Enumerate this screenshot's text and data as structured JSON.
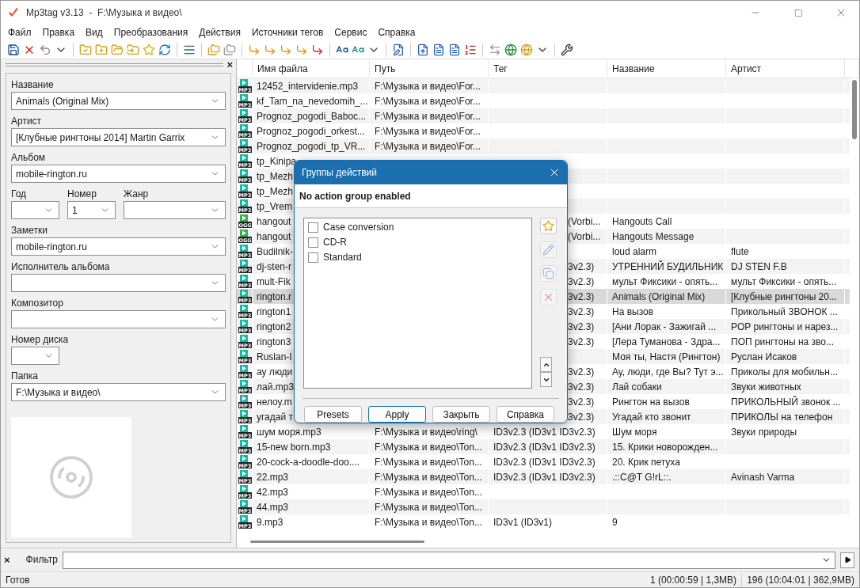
{
  "window": {
    "title": "Mp3tag v3.13  -  F:\\Музыка и видео\\"
  },
  "menu": [
    "Файл",
    "Правка",
    "Вид",
    "Преобразования",
    "Действия",
    "Источники тегов",
    "Сервис",
    "Справка"
  ],
  "tag_panel": {
    "close": "×",
    "rows": [
      [
        {
          "label": "Название",
          "value": "Animals (Original Mix)",
          "kind": "text"
        }
      ],
      [
        {
          "label": "Артист",
          "value": "[Клубные рингтоны 2014] Martin Garrix",
          "kind": "text"
        }
      ],
      [
        {
          "label": "Альбом",
          "value": "mobile-rington.ru",
          "kind": "text"
        }
      ],
      [
        {
          "label": "Год",
          "kind": "number"
        },
        {
          "label": "Номер",
          "value": "1",
          "kind": "number"
        },
        {
          "label": "Жанр",
          "kind": "text"
        }
      ],
      [
        {
          "label": "Заметки",
          "value": "mobile-rington.ru",
          "kind": "text"
        }
      ],
      [
        {
          "label": "Исполнитель альбома",
          "kind": "text"
        }
      ],
      [
        {
          "label": "Композитор",
          "kind": "text"
        }
      ],
      [
        {
          "label": "Номер диска",
          "kind": "number"
        }
      ],
      [
        {
          "label": "Папка",
          "value": "F:\\Музыка и видео\\",
          "kind": "text"
        }
      ]
    ]
  },
  "table": {
    "columns": [
      "Имя файла",
      "Путь",
      "Тег",
      "Название",
      "Артист"
    ],
    "rows": [
      {
        "format": "MP3",
        "cells": [
          "12452_intervidenie.mp3",
          "F:\\Музыка и видео\\For...",
          "",
          "",
          ""
        ],
        "selected": false
      },
      {
        "format": "MP3",
        "cells": [
          "kf_Tam_na_nevedomih_...",
          "F:\\Музыка и видео\\For...",
          "",
          "",
          ""
        ],
        "selected": false
      },
      {
        "format": "MP3",
        "cells": [
          "Prognoz_pogodi_Baboc...",
          "F:\\Музыка и видео\\For...",
          "",
          "",
          ""
        ],
        "selected": false
      },
      {
        "format": "MP3",
        "cells": [
          "Prognoz_pogodi_orkest...",
          "F:\\Музыка и видео\\For...",
          "",
          "",
          ""
        ],
        "selected": false
      },
      {
        "format": "MP3",
        "cells": [
          "Prognoz_pogodi_tp_VR...",
          "F:\\Музыка и видео\\For...",
          "",
          "",
          ""
        ],
        "selected": false
      },
      {
        "format": "MP3",
        "cells": [
          "tp_Kinipa",
          "",
          "",
          "",
          ""
        ],
        "selected": false
      },
      {
        "format": "MP3",
        "cells": [
          "tp_Mezh",
          "",
          "",
          "",
          ""
        ],
        "selected": false
      },
      {
        "format": "MP3",
        "cells": [
          "tp_Mezh",
          "",
          "",
          "",
          ""
        ],
        "selected": false
      },
      {
        "format": "MP3",
        "cells": [
          "tp_Vrem",
          "",
          "",
          "",
          ""
        ],
        "selected": false
      },
      {
        "format": "OGG",
        "cells": [
          "hangout",
          "",
          "(Vorbi...",
          "Hangouts Call",
          ""
        ],
        "selected": false
      },
      {
        "format": "OGG",
        "cells": [
          "hangout",
          "",
          "(Vorbi...",
          "Hangouts Message",
          ""
        ],
        "selected": false
      },
      {
        "format": "MP3",
        "cells": [
          "Budilnik-",
          "",
          "",
          "loud alarm",
          "flute"
        ],
        "selected": false
      },
      {
        "format": "MP3",
        "cells": [
          "dj-sten-r",
          "",
          "3v2.3)",
          "УТРЕННИЙ БУДИЛЬНИК",
          "DJ STEN F.B"
        ],
        "selected": false
      },
      {
        "format": "MP3",
        "cells": [
          "mult-Fik",
          "",
          "3v2.3)",
          "мульт Фиксики - опять...",
          "мульт Фиксики - опять..."
        ],
        "selected": false
      },
      {
        "format": "MP3",
        "cells": [
          "rington.r",
          "",
          "3v2.3)",
          "Animals (Original Mix)",
          "[Клубные рингтоны 20..."
        ],
        "selected": true
      },
      {
        "format": "MP3",
        "cells": [
          "rington1",
          "",
          "3v2.3)",
          "На вызов",
          "Прикольный ЗВОНОК ..."
        ],
        "selected": false
      },
      {
        "format": "MP3",
        "cells": [
          "rington2",
          "",
          "3v2.3)",
          "[Ани Лорак - Зажигай ...",
          "POP рингтоны и нарез..."
        ],
        "selected": false
      },
      {
        "format": "MP3",
        "cells": [
          "rington3",
          "",
          "3v2.3)",
          "[Лера Туманова - Здра...",
          "ПОП рингтоны на зво..."
        ],
        "selected": false
      },
      {
        "format": "MP3",
        "cells": [
          "Ruslan-I",
          "",
          "",
          "Моя ты, Настя (Рингтон)",
          "Руслан Исаков"
        ],
        "selected": false
      },
      {
        "format": "MP3",
        "cells": [
          "ау люди",
          "",
          "3v2.3)",
          "Ау, люди, где Вы? Тут э...",
          "Приколы для мобильн..."
        ],
        "selected": false
      },
      {
        "format": "MP3",
        "cells": [
          "лай.mp3",
          "",
          "3v2.3)",
          "Лай собаки",
          "Звуки животных"
        ],
        "selected": false
      },
      {
        "format": "MP3",
        "cells": [
          "нелоу.m",
          "",
          "3v2.3)",
          "Рингтон на вызов",
          "ПРИКОЛЬНЫЙ звонок ..."
        ],
        "selected": false
      },
      {
        "format": "MP3",
        "cells": [
          "угадай т",
          "",
          "3v2.3)",
          "Угадай кто звонит",
          "ПРИКОЛЫ на телефон"
        ],
        "selected": false
      },
      {
        "format": "MP3",
        "cells": [
          "шум моря.mp3",
          "F:\\Музыка и видео\\ring\\",
          "ID3v2.3 (ID3v1 ID3v2.3)",
          "Шум моря",
          "Звуки природы"
        ],
        "selected": false
      },
      {
        "format": "MP3",
        "cells": [
          "15-new born.mp3",
          "F:\\Музыка и видео\\Ton...",
          "ID3v2.3 (ID3v1 ID3v2.3)",
          "15. Крики новорожден...",
          ""
        ],
        "selected": false
      },
      {
        "format": "MP3",
        "cells": [
          "20-cock-a-doodle-doo....",
          "F:\\Музыка и видео\\Ton...",
          "ID3v2.3 (ID3v1 ID3v2.3)",
          "20. Крик петуха",
          ""
        ],
        "selected": false
      },
      {
        "format": "MP3",
        "cells": [
          "22.mp3",
          "F:\\Музыка и видео\\Ton...",
          "ID3v2.3 (ID3v1 ID3v2.3)",
          ".::C@T G!rL::.",
          "Avinash Varma"
        ],
        "selected": false
      },
      {
        "format": "MP3",
        "cells": [
          "42.mp3",
          "F:\\Музыка и видео\\Ton...",
          "",
          "",
          ""
        ],
        "selected": false
      },
      {
        "format": "MP3",
        "cells": [
          "44.mp3",
          "F:\\Музыка и видео\\Ton...",
          "",
          "",
          ""
        ],
        "selected": false
      },
      {
        "format": "MP3",
        "cells": [
          "9.mp3",
          "F:\\Музыка и видео\\Ton...",
          "ID3v1 (ID3v1)",
          "9",
          ""
        ],
        "selected": false
      }
    ]
  },
  "dialog": {
    "title": "Группы действий",
    "message": "No action group enabled",
    "groups": [
      {
        "label": "Case conversion",
        "checked": false
      },
      {
        "label": "CD-R",
        "checked": false
      },
      {
        "label": "Standard",
        "checked": false
      }
    ],
    "side_buttons": [
      {
        "kind": "new",
        "disabled": false
      },
      {
        "kind": "edit",
        "disabled": true
      },
      {
        "kind": "copy",
        "disabled": true
      },
      {
        "kind": "delete",
        "disabled": true
      }
    ],
    "buttons": [
      {
        "label": "Presets",
        "default": false
      },
      {
        "label": "Apply",
        "default": true
      },
      {
        "label": "Закрыть",
        "default": false
      },
      {
        "label": "Справка",
        "default": false
      }
    ]
  },
  "filter": {
    "close": "×",
    "label": "Фильтр"
  },
  "status_bar": {
    "text": "Готов",
    "selection": "1 (00:00:59 | 1,3MB)",
    "total": "196 (10:04:01 | 362,9MB)"
  }
}
